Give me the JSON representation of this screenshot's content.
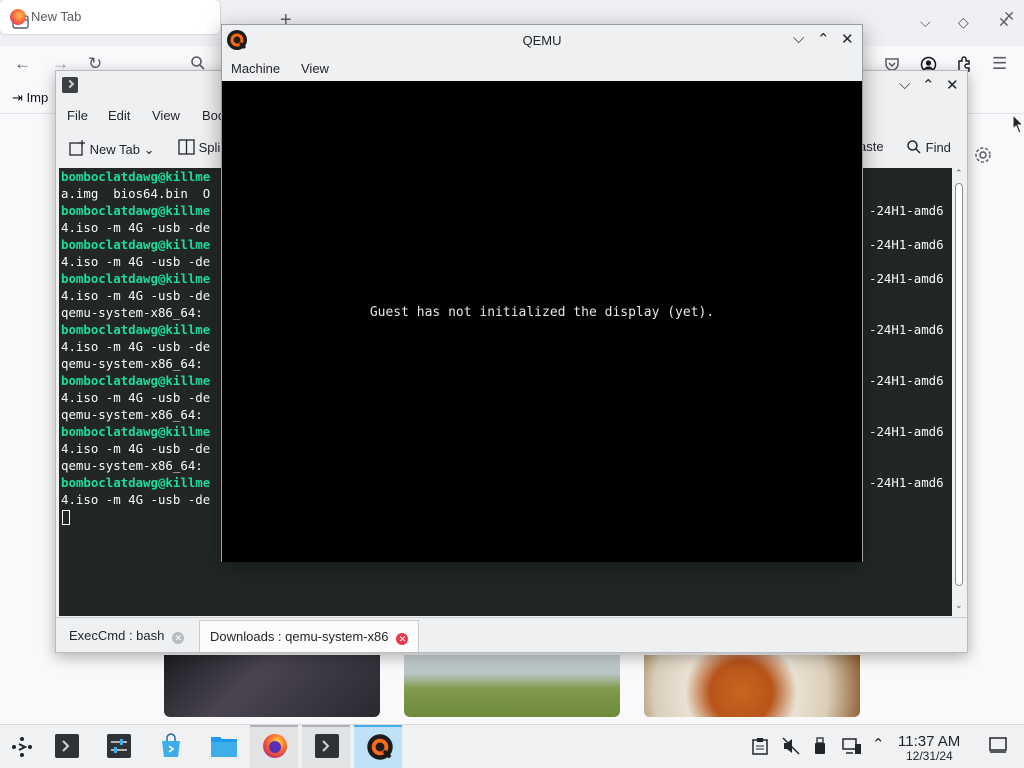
{
  "firefox": {
    "tab_title": "New Tab",
    "import_label": "Imp"
  },
  "konsole": {
    "menu": [
      "File",
      "Edit",
      "View",
      "Boo"
    ],
    "toolbar": {
      "new_tab": "New Tab",
      "split": "Spli",
      "paste": "aste",
      "find": "Find"
    },
    "terminal_left": [
      {
        "text": "bomboclatdawg@killme",
        "prompt": true
      },
      {
        "text": "a.img  bios64.bin  O",
        "prompt": false
      },
      {
        "text": "bomboclatdawg@killme",
        "prompt": true
      },
      {
        "text": "4.iso -m 4G -usb -de",
        "prompt": false
      },
      {
        "text": "bomboclatdawg@killme",
        "prompt": true
      },
      {
        "text": "4.iso -m 4G -usb -de",
        "prompt": false
      },
      {
        "text": "bomboclatdawg@killme",
        "prompt": true
      },
      {
        "text": "4.iso -m 4G -usb -de",
        "prompt": false
      },
      {
        "text": "qemu-system-x86_64: ",
        "prompt": false
      },
      {
        "text": "bomboclatdawg@killme",
        "prompt": true
      },
      {
        "text": "4.iso -m 4G -usb -de",
        "prompt": false
      },
      {
        "text": "qemu-system-x86_64: ",
        "prompt": false
      },
      {
        "text": "bomboclatdawg@killme",
        "prompt": true
      },
      {
        "text": "4.iso -m 4G -usb -de",
        "prompt": false
      },
      {
        "text": "qemu-system-x86_64: ",
        "prompt": false
      },
      {
        "text": "bomboclatdawg@killme",
        "prompt": true
      },
      {
        "text": "4.iso -m 4G -usb -de",
        "prompt": false
      },
      {
        "text": "qemu-system-x86_64: ",
        "prompt": false
      },
      {
        "text": "bomboclatdawg@killme",
        "prompt": true
      },
      {
        "text": "4.iso -m 4G -usb -de",
        "prompt": false
      }
    ],
    "terminal_right": [
      {
        "row": 2,
        "text": "-24H1-amd6"
      },
      {
        "row": 4,
        "text": "-24H1-amd6"
      },
      {
        "row": 6,
        "text": "-24H1-amd6"
      },
      {
        "row": 9,
        "text": "-24H1-amd6"
      },
      {
        "row": 12,
        "text": "-24H1-amd6"
      },
      {
        "row": 15,
        "text": "-24H1-amd6"
      },
      {
        "row": 18,
        "text": "-24H1-amd6"
      }
    ],
    "tabs": [
      {
        "label": "ExecCmd : bash",
        "active": false
      },
      {
        "label": "Downloads : qemu-system-x86",
        "active": true
      }
    ]
  },
  "qemu": {
    "title": "QEMU",
    "menu": [
      "Machine",
      "View"
    ],
    "screen_message": "Guest has not initialized the display (yet)."
  },
  "taskbar": {
    "time": "11:37 AM",
    "date": "12/31/24",
    "apps": [
      "application-launcher",
      "konsole",
      "system-settings",
      "discover",
      "dolphin",
      "firefox",
      "konsole",
      "qemu"
    ]
  },
  "colors": {
    "prompt_green": "#1cdc9a",
    "terminal_bg": "#232627",
    "accent_blue": "#3daee9",
    "close_red": "#e93a4c"
  }
}
